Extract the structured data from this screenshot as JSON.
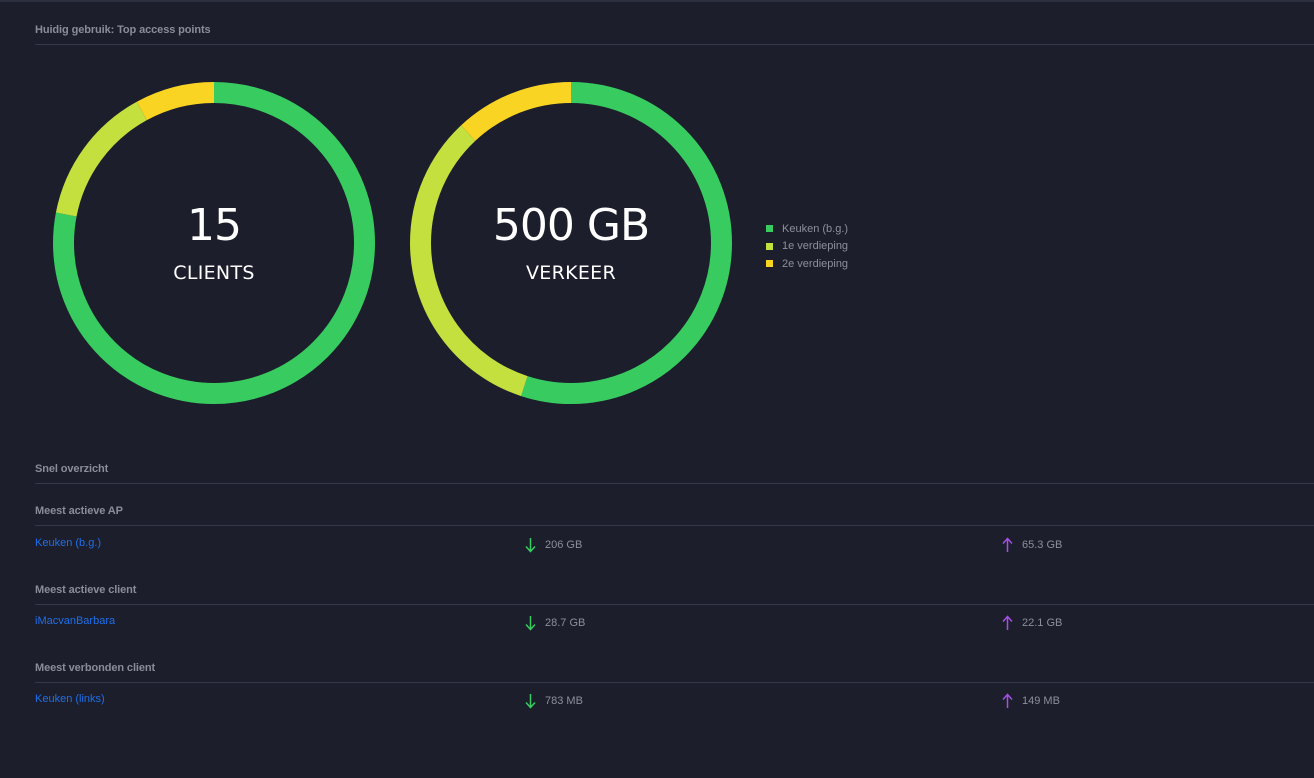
{
  "header": {
    "title": "Huidig gebruik: Top access points"
  },
  "colors": {
    "background": "#1c1e2c",
    "green": "#38cc60",
    "lime": "#c4e03e",
    "yellow": "#fad423",
    "link": "#1f6fe8",
    "download_arrow": "#38cc60",
    "upload_arrow": "#a64ee8"
  },
  "donuts": {
    "clients": {
      "value": "15",
      "label": "CLIENTS",
      "segments": [
        {
          "name": "Keuken (b.g.)",
          "fraction": 0.78
        },
        {
          "name": "1e verdieping",
          "fraction": 0.14
        },
        {
          "name": "2e verdieping",
          "fraction": 0.08
        }
      ]
    },
    "traffic": {
      "value": "500 GB",
      "label": "VERKEER",
      "segments": [
        {
          "name": "Keuken (b.g.)",
          "fraction": 0.55
        },
        {
          "name": "1e verdieping",
          "fraction": 0.33
        },
        {
          "name": "2e verdieping",
          "fraction": 0.12
        }
      ]
    }
  },
  "legend": [
    {
      "label": "Keuken (b.g.)",
      "color": "#38cc60"
    },
    {
      "label": "1e verdieping",
      "color": "#c4e03e"
    },
    {
      "label": "2e verdieping",
      "color": "#fad423"
    }
  ],
  "overview": {
    "title": "Snel overzicht",
    "most_active_ap": {
      "title": "Meest actieve AP",
      "name": "Keuken (b.g.)",
      "download": "206 GB",
      "upload": "65.3 GB"
    },
    "most_active_client": {
      "title": "Meest actieve client",
      "name": "iMacvanBarbara",
      "download": "28.7 GB",
      "upload": "22.1 GB"
    },
    "most_connected_client": {
      "title": "Meest verbonden client",
      "name": "Keuken (links)",
      "download": "783 MB",
      "upload": "149 MB"
    }
  }
}
